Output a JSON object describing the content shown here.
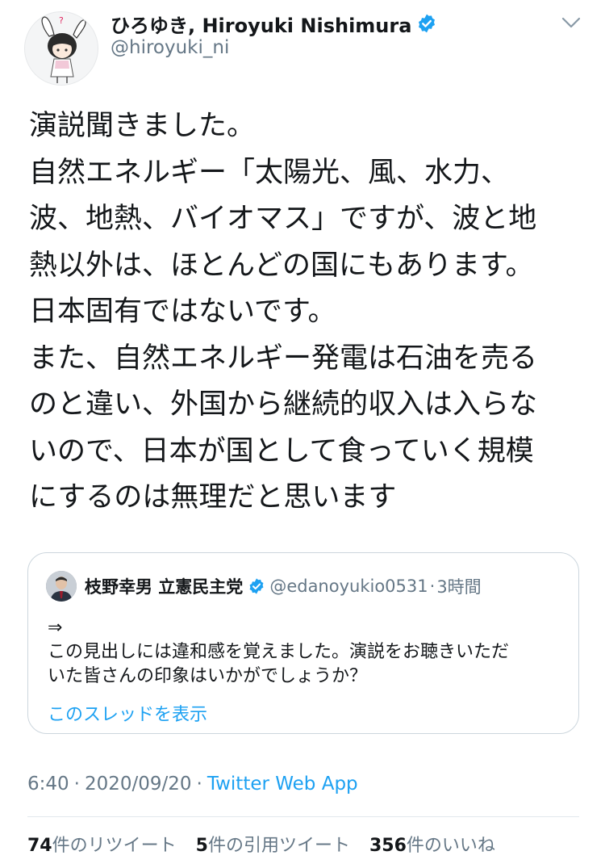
{
  "author": {
    "display_name": "ひろゆき, Hiroyuki Nishimura",
    "handle": "@hiroyuki_ni",
    "verified_icon": "verified-badge-icon",
    "avatar_icon": "bunny-ear-character-avatar",
    "avatar_mark": "?"
  },
  "tweet": {
    "lines": [
      "演説聞きました。",
      "自然エネルギー「太陽光、風、水力、",
      "波、地熱、バイオマス」ですが、波と地",
      "熱以外は、ほとんどの国にもあります。",
      "日本固有ではないです。",
      "また、自然エネルギー発電は石油を売る",
      "のと違い、外国から継続的収入は入らな",
      "いので、日本が国として食っていく規模",
      "にするのは無理だと思います"
    ]
  },
  "quote": {
    "display_name": "枝野幸男 立憲民主党",
    "handle": "@edanoyukio0531",
    "dot": "·",
    "time": "3時間",
    "lines": [
      "⇒",
      "この見出しには違和感を覚えました。演説をお聴きいただ",
      "いた皆さんの印象はいかがでしょうか？"
    ],
    "show_thread": "このスレッドを表示"
  },
  "meta": {
    "time": "6:40",
    "sep1": "·",
    "date": "2020/09/20",
    "sep2": "·",
    "source": "Twitter Web App"
  },
  "stats": {
    "retweets": {
      "num": "74",
      "label": "件のリツイート"
    },
    "quotes": {
      "num": "5",
      "label": "件の引用ツイート"
    },
    "likes": {
      "num": "356",
      "label": "件のいいね"
    }
  },
  "colors": {
    "link": "#1da1f2",
    "secondary": "#657786",
    "border": "#ccd6dd",
    "text": "#14171a"
  }
}
